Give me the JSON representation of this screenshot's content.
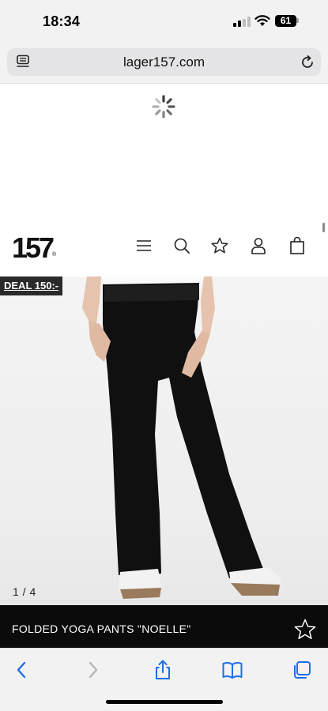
{
  "status_bar": {
    "time": "18:34",
    "battery_level": "61",
    "icons": [
      "signal-icon",
      "wifi-icon",
      "battery-icon"
    ]
  },
  "browser": {
    "url": "lager157.com",
    "icons": [
      "page-menu-icon",
      "reload-icon"
    ]
  },
  "loading": {
    "icon": "loading-spinner-icon"
  },
  "site_header": {
    "logo_text": "157",
    "logo_mark": "®",
    "icons": [
      "menu-icon",
      "search-icon",
      "favorites-star-icon",
      "account-icon",
      "shopping-bag-icon"
    ]
  },
  "product": {
    "deal_badge": "DEAL 150:-",
    "image_counter": "1 / 4",
    "title": "FOLDED YOGA PANTS \"NOELLE\"",
    "colors": {
      "title_bar": "#0b0b0b",
      "title_text": "#ffffff",
      "badge_bg": "#2a2a2a"
    }
  },
  "toolbar": {
    "icons": [
      "back-icon",
      "forward-icon",
      "share-icon",
      "bookmarks-icon",
      "tabs-icon"
    ],
    "accent_color": "#1f6fe5"
  }
}
